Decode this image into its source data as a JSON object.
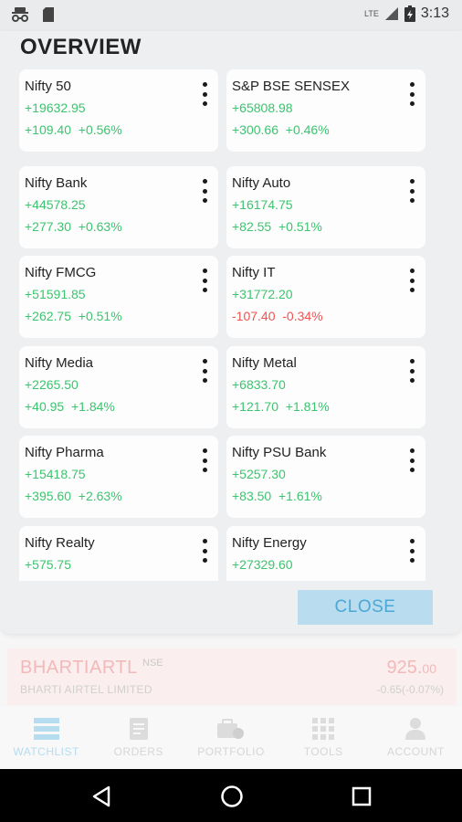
{
  "status_bar": {
    "time": "3:13",
    "network": "LTE"
  },
  "overview": {
    "title": "OVERVIEW",
    "cards": [
      {
        "name": "Nifty 50",
        "value": "+19632.95",
        "change": "+109.40",
        "pct": "+0.56%",
        "negative": false
      },
      {
        "name": "S&P BSE SENSEX",
        "value": "+65808.98",
        "change": "+300.66",
        "pct": "+0.46%",
        "negative": false
      },
      {
        "name": "Nifty Bank",
        "value": "+44578.25",
        "change": "+277.30",
        "pct": "+0.63%",
        "negative": false
      },
      {
        "name": "Nifty Auto",
        "value": "+16174.75",
        "change": "+82.55",
        "pct": "+0.51%",
        "negative": false
      },
      {
        "name": "Nifty FMCG",
        "value": "+51591.85",
        "change": "+262.75",
        "pct": "+0.51%",
        "negative": false
      },
      {
        "name": "Nifty IT",
        "value": "+31772.20",
        "change": "-107.40",
        "pct": "-0.34%",
        "negative": true
      },
      {
        "name": "Nifty Media",
        "value": "+2265.50",
        "change": "+40.95",
        "pct": "+1.84%",
        "negative": false
      },
      {
        "name": "Nifty Metal",
        "value": "+6833.70",
        "change": "+121.70",
        "pct": "+1.81%",
        "negative": false
      },
      {
        "name": "Nifty Pharma",
        "value": "+15418.75",
        "change": "+395.60",
        "pct": "+2.63%",
        "negative": false
      },
      {
        "name": "Nifty PSU Bank",
        "value": "+5257.30",
        "change": "+83.50",
        "pct": "+1.61%",
        "negative": false
      },
      {
        "name": "Nifty Realty",
        "value": "+575.75",
        "change": "",
        "pct": "",
        "negative": false
      },
      {
        "name": "Nifty Energy",
        "value": "+27329.60",
        "change": "",
        "pct": "",
        "negative": false
      }
    ],
    "close_label": "CLOSE"
  },
  "stock": {
    "symbol": "BHARTIARTL",
    "exchange": "NSE",
    "name": "BHARTI AIRTEL LIMITED",
    "price_main": "925.",
    "price_dec": "00",
    "change": "-0.65(-0.07%)"
  },
  "nav": [
    {
      "label": "WATCHLIST",
      "icon": "watchlist-icon",
      "active": true
    },
    {
      "label": "ORDERS",
      "icon": "orders-icon",
      "active": false
    },
    {
      "label": "PORTFOLIO",
      "icon": "portfolio-icon",
      "active": false
    },
    {
      "label": "TOOLS",
      "icon": "tools-icon",
      "active": false
    },
    {
      "label": "ACCOUNT",
      "icon": "account-icon",
      "active": false
    }
  ],
  "colors": {
    "positive": "#3cc46f",
    "negative": "#ef5350",
    "accent": "#4ba8d6"
  }
}
